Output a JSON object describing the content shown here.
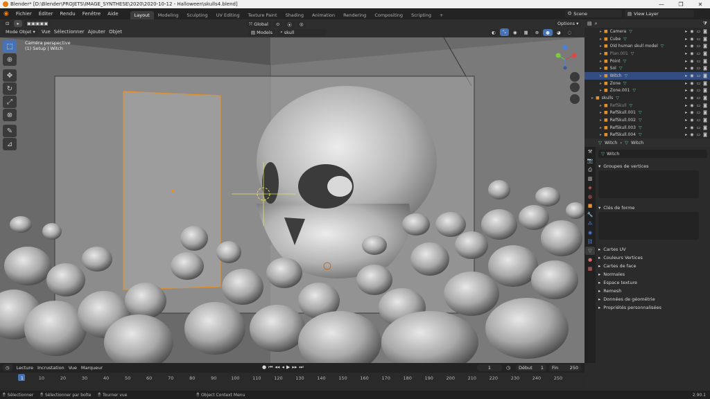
{
  "window": {
    "title": "Blender* [D:\\Blender\\PROJETS\\IMAGE_SYNTHESE\\2020\\2020-10-12 - Halloween\\skulls4.blend]",
    "min": "—",
    "max": "❐",
    "close": "✕"
  },
  "menu": {
    "items": [
      "Fichier",
      "Éditer",
      "Rendu",
      "Fenêtre",
      "Aide"
    ]
  },
  "workspaces": [
    "Layout",
    "Modeling",
    "Sculpting",
    "UV Editing",
    "Texture Paint",
    "Shading",
    "Animation",
    "Rendering",
    "Compositing",
    "Scripting"
  ],
  "active_workspace": "Layout",
  "scene": {
    "name": "Scene",
    "view_layer": "View Layer"
  },
  "viewport_header": {
    "mode": "Mode Objet",
    "menus": [
      "Vue",
      "Sélectionner",
      "Ajouter",
      "Objet"
    ],
    "transform": "Global",
    "collection": "Models",
    "search": "skull",
    "options": "Options"
  },
  "viewport": {
    "camera_label": "Caméra perspective",
    "object_label": "(1) Setup | Witch"
  },
  "outliner": {
    "rows": [
      {
        "name": "Camera",
        "dim": false,
        "selected": false
      },
      {
        "name": "Cube",
        "dim": false,
        "selected": false
      },
      {
        "name": "Old human skull model",
        "dim": false,
        "selected": false
      },
      {
        "name": "Plan.001",
        "dim": true,
        "selected": false
      },
      {
        "name": "Point",
        "dim": false,
        "selected": false
      },
      {
        "name": "Sol",
        "dim": false,
        "selected": false
      },
      {
        "name": "Witch",
        "dim": false,
        "selected": true
      },
      {
        "name": "Zone",
        "dim": false,
        "selected": false
      },
      {
        "name": "Zone.001",
        "dim": false,
        "selected": false
      },
      {
        "name": "skulls",
        "dim": false,
        "selected": false
      },
      {
        "name": "RefSkull",
        "dim": true,
        "selected": false
      },
      {
        "name": "RefSkull.001",
        "dim": false,
        "selected": false
      },
      {
        "name": "RefSkull.002",
        "dim": false,
        "selected": false
      },
      {
        "name": "RefSkull.003",
        "dim": false,
        "selected": false
      },
      {
        "name": "RefSkull.004",
        "dim": false,
        "selected": false
      }
    ]
  },
  "properties": {
    "breadcrumb_obj": "Witch",
    "breadcrumb_data": "Witch",
    "data_name": "Witch",
    "vertex_groups": "Groupes de vertices",
    "shape_keys": "Clés de forme",
    "collapsed_panels": [
      "Cartes UV",
      "Couleurs Vertices",
      "Cartes de face",
      "Normales",
      "Espace texture",
      "Remesh",
      "Données de géométrie",
      "Propriétés personnalisées"
    ]
  },
  "timeline": {
    "menus": [
      "Lecture",
      "Incrustation",
      "Vue",
      "Marqueur"
    ],
    "current_frame": "1",
    "start_label": "Début",
    "start": "1",
    "end_label": "Fin",
    "end": "250",
    "ticks": [
      "1",
      "10",
      "20",
      "30",
      "40",
      "50",
      "60",
      "70",
      "80",
      "90",
      "100",
      "110",
      "120",
      "130",
      "140",
      "150",
      "160",
      "170",
      "180",
      "190",
      "200",
      "210",
      "220",
      "230",
      "240",
      "250"
    ]
  },
  "status": {
    "select": "Sélectionner",
    "box_select": "Sélectionner par boîte",
    "rotate": "Tourner vue",
    "context": "Object Context Menu",
    "version": "2.90.1"
  },
  "colors": {
    "accent": "#4772b3",
    "selection_orange": "#e8902a",
    "mesh_green": "#6ec6a0"
  }
}
